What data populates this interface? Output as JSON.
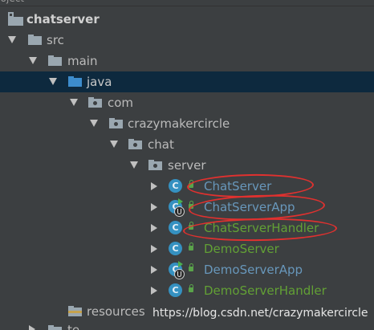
{
  "header": {
    "label": "roject"
  },
  "tree": {
    "chatserver": "chatserver",
    "src": "src",
    "main": "main",
    "java": "java",
    "com": "com",
    "crazymakercircle": "crazymakercircle",
    "chat": "chat",
    "server": "server",
    "classes": [
      {
        "label": "ChatServer",
        "icon": "class-icon"
      },
      {
        "label": "ChatServerApp",
        "icon": "runnable-class-icon"
      },
      {
        "label": "ChatServerHandler",
        "icon": "class-icon"
      },
      {
        "label": "DemoServer",
        "icon": "class-icon"
      },
      {
        "label": "DemoServerApp",
        "icon": "runnable-class-icon"
      },
      {
        "label": "DemoServerHandler",
        "icon": "class-icon"
      }
    ],
    "resources": "resources",
    "next_partial": "te"
  },
  "watermark": "https://blog.csdn.net/crazymakercircle",
  "colors": {
    "background": "#3c3f41",
    "selection": "#0d293e",
    "class_blue": "#6897bb",
    "class_green": "#62a035",
    "annotation_red": "#e0312f"
  }
}
